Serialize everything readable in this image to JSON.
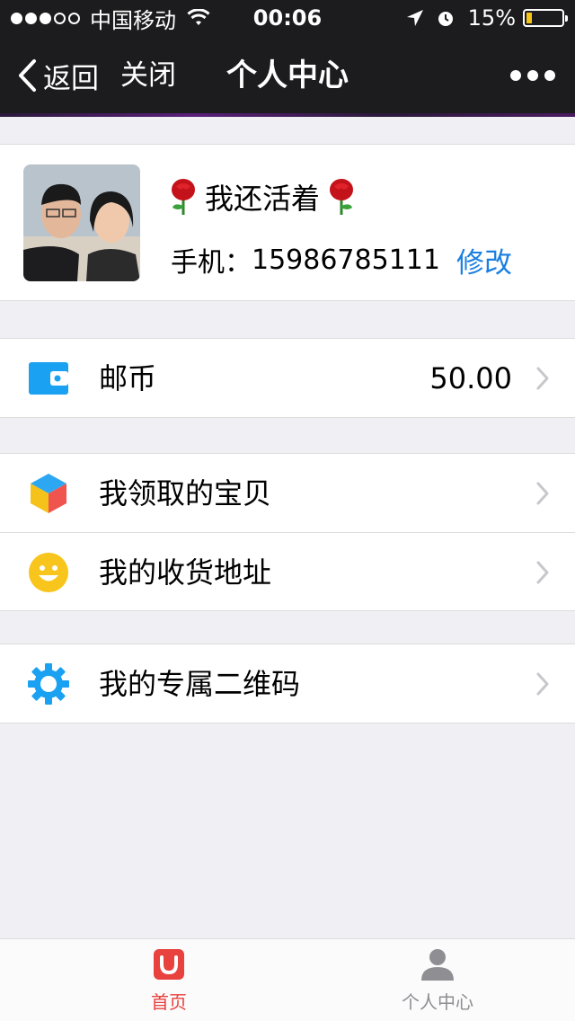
{
  "status_bar": {
    "carrier": "中国移动",
    "time": "00:06",
    "battery": "15%"
  },
  "navbar": {
    "back_label": "返回",
    "close_label": "关闭",
    "title": "个人中心"
  },
  "profile": {
    "nickname": "我还活着",
    "phone_label": "手机：",
    "phone": "15986785111",
    "edit_label": "修改"
  },
  "menu": {
    "coins": {
      "label": "邮币",
      "value": "50.00"
    },
    "received_items": {
      "label": "我领取的宝贝"
    },
    "address": {
      "label": "我的收货地址"
    },
    "qrcode": {
      "label": "我的专属二维码"
    }
  },
  "tabbar": {
    "home_label": "首页",
    "profile_label": "个人中心"
  },
  "colors": {
    "accent_blue": "#1a7fe0",
    "tab_active": "#e8413e",
    "wallet_icon": "#1aa1f2"
  }
}
